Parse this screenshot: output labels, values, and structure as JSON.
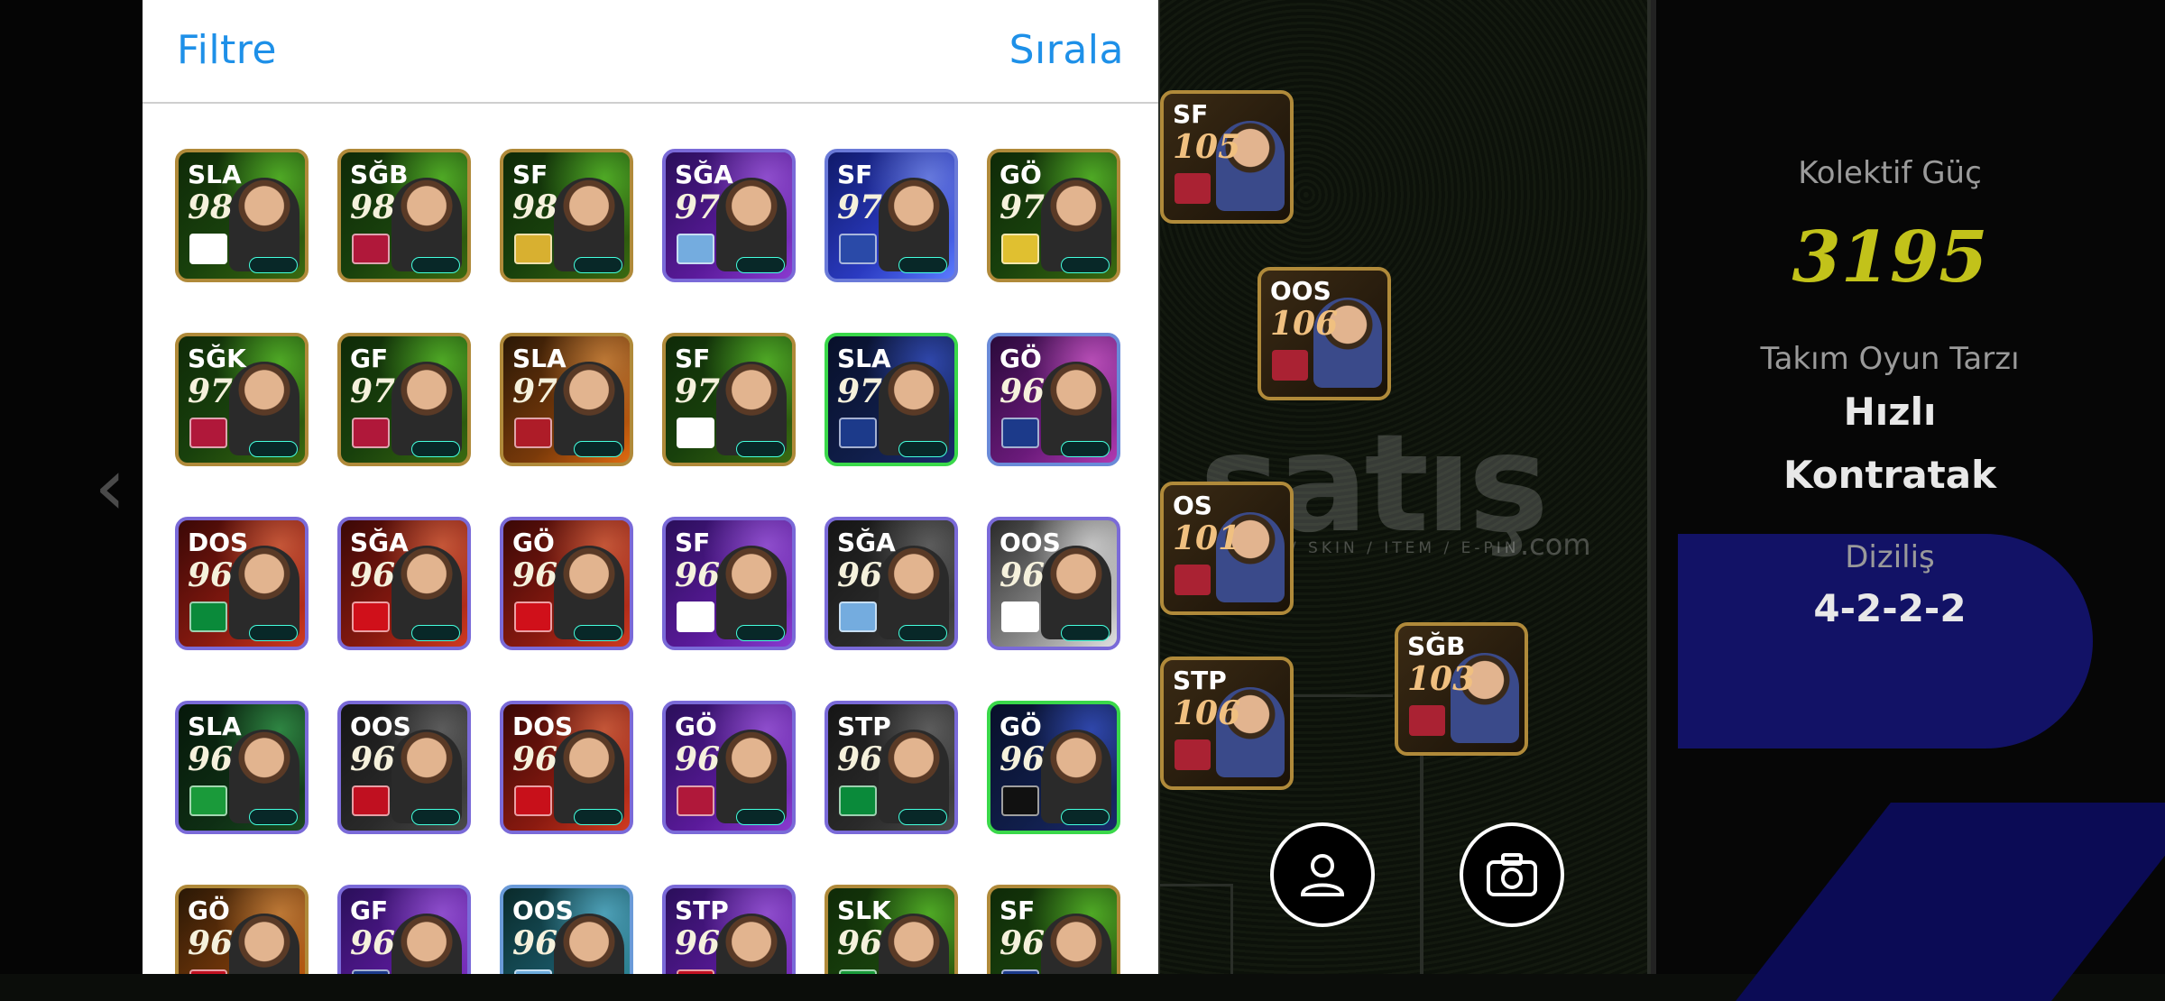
{
  "header": {
    "filter_label": "Filtre",
    "sort_label": "Sırala"
  },
  "cards": [
    {
      "pos": "SLA",
      "rating": "98",
      "theme": "green",
      "badge": "#ffffff"
    },
    {
      "pos": "SĞB",
      "rating": "98",
      "theme": "green",
      "badge": "#b0183a"
    },
    {
      "pos": "SF",
      "rating": "98",
      "theme": "green",
      "badge": "#d8b030"
    },
    {
      "pos": "SĞA",
      "rating": "97",
      "theme": "purple",
      "badge": "#74acdf"
    },
    {
      "pos": "SF",
      "rating": "97",
      "theme": "blue",
      "badge": "#2a4aa8"
    },
    {
      "pos": "GÖ",
      "rating": "97",
      "theme": "green",
      "badge": "#e0c030"
    },
    {
      "pos": "SĞK",
      "rating": "97",
      "theme": "green",
      "badge": "#b0183a"
    },
    {
      "pos": "GF",
      "rating": "97",
      "theme": "green",
      "badge": "#b0183a"
    },
    {
      "pos": "SLA",
      "rating": "97",
      "theme": "orange",
      "badge": "#ae1c28"
    },
    {
      "pos": "SF",
      "rating": "97",
      "theme": "green",
      "badge": "#ffffff"
    },
    {
      "pos": "SLA",
      "rating": "97",
      "theme": "navy",
      "badge": "#1c3a8a"
    },
    {
      "pos": "GÖ",
      "rating": "96",
      "theme": "magenta",
      "badge": "#1c3a8a"
    },
    {
      "pos": "DOS",
      "rating": "96",
      "theme": "red",
      "badge": "#0a8a3a"
    },
    {
      "pos": "SĞA",
      "rating": "96",
      "theme": "red",
      "badge": "#d0101a"
    },
    {
      "pos": "GÖ",
      "rating": "96",
      "theme": "red",
      "badge": "#d0101a"
    },
    {
      "pos": "SF",
      "rating": "96",
      "theme": "purple",
      "badge": "#ffffff"
    },
    {
      "pos": "SĞA",
      "rating": "96",
      "theme": "dark",
      "badge": "#74acdf"
    },
    {
      "pos": "OOS",
      "rating": "96",
      "theme": "white",
      "badge": "#ffffff"
    },
    {
      "pos": "SLA",
      "rating": "96",
      "theme": "darkgreen",
      "badge": "#1a9a3a"
    },
    {
      "pos": "OOS",
      "rating": "96",
      "theme": "dark",
      "badge": "#c01020"
    },
    {
      "pos": "DOS",
      "rating": "96",
      "theme": "red",
      "badge": "#c8101a"
    },
    {
      "pos": "GÖ",
      "rating": "96",
      "theme": "purple",
      "badge": "#b0183a"
    },
    {
      "pos": "STP",
      "rating": "96",
      "theme": "dark",
      "badge": "#0a8a3a"
    },
    {
      "pos": "GÖ",
      "rating": "96",
      "theme": "navy",
      "badge": "#111111"
    },
    {
      "pos": "GÖ",
      "rating": "96",
      "theme": "orange",
      "badge": "#c01020"
    },
    {
      "pos": "GF",
      "rating": "96",
      "theme": "purple",
      "badge": "#1c3a8a"
    },
    {
      "pos": "OOS",
      "rating": "96",
      "theme": "teal",
      "badge": "#6cabdd"
    },
    {
      "pos": "STP",
      "rating": "96",
      "theme": "purple",
      "badge": "#c01020"
    },
    {
      "pos": "SLK",
      "rating": "96",
      "theme": "green",
      "badge": "#1a9a3a"
    },
    {
      "pos": "SF",
      "rating": "96",
      "theme": "green",
      "badge": "#1c3a8a"
    }
  ],
  "pitch_cards": [
    {
      "pos": "SF",
      "rating": "105"
    },
    {
      "pos": "OOS",
      "rating": "106"
    },
    {
      "pos": "OS",
      "rating": "101"
    },
    {
      "pos": "STP",
      "rating": "106"
    },
    {
      "pos": "SĞB",
      "rating": "103"
    }
  ],
  "watermark": {
    "main": "satış",
    "sub": "HESAP / SKIN / ITEM / E-PIN",
    "com": ".com"
  },
  "info": {
    "power_label": "Kolektif Güç",
    "power_value": "3195",
    "style_label": "Takım Oyun Tarzı",
    "style_value_1": "Hızlı",
    "style_value_2": "Kontratak",
    "formation_label": "Diziliş",
    "formation_value": "4-2-2-2"
  },
  "icons": {
    "back": "chevron-left-icon",
    "profile": "user-icon",
    "camera": "camera-icon"
  },
  "colors": {
    "accent_blue": "#1e90e8",
    "power_yellow": "#c2c21a"
  }
}
